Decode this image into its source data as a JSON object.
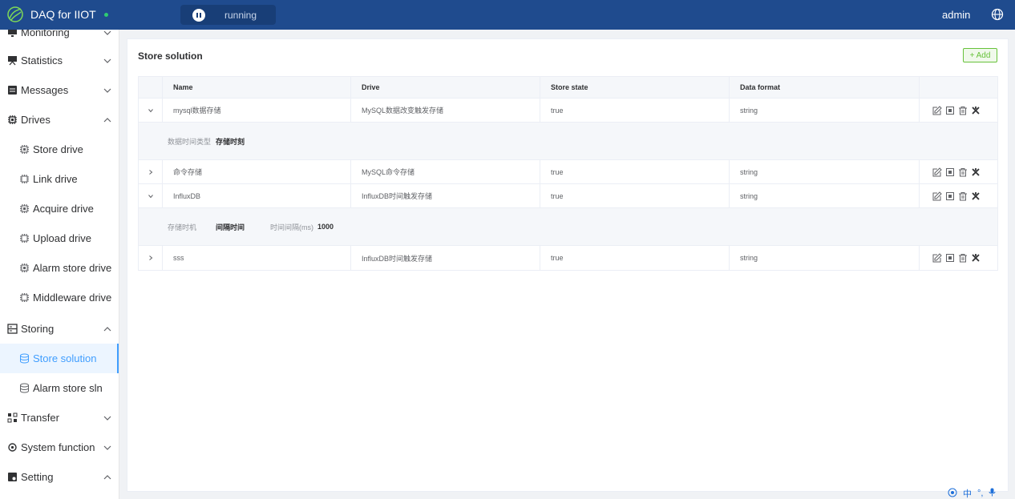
{
  "header": {
    "app_title": "DAQ for IIOT",
    "status": "running",
    "user": "admin"
  },
  "sidebar": {
    "items": [
      {
        "label": "Monitoring",
        "icon": "monitor-icon",
        "chevron": "down"
      },
      {
        "label": "Statistics",
        "icon": "presentation-icon",
        "chevron": "down"
      },
      {
        "label": "Messages",
        "icon": "message-icon",
        "chevron": "down"
      },
      {
        "label": "Drives",
        "icon": "chip-icon",
        "chevron": "up"
      },
      {
        "label": "Storing",
        "icon": "storage-icon",
        "chevron": "up"
      },
      {
        "label": "Transfer",
        "icon": "transfer-icon",
        "chevron": "down"
      },
      {
        "label": "System function",
        "icon": "system-icon",
        "chevron": "down"
      },
      {
        "label": "Setting",
        "icon": "setting-icon",
        "chevron": "up"
      }
    ],
    "drives_sub": [
      {
        "label": "Store drive"
      },
      {
        "label": "Link drive"
      },
      {
        "label": "Acquire drive"
      },
      {
        "label": "Upload drive"
      },
      {
        "label": "Alarm store drive"
      },
      {
        "label": "Middleware drive"
      }
    ],
    "storing_sub": [
      {
        "label": "Store solution",
        "active": true
      },
      {
        "label": "Alarm store sln"
      }
    ]
  },
  "main": {
    "title": "Store solution",
    "add_label": "+ Add",
    "columns": [
      "Name",
      "Drive",
      "Store state",
      "Data format"
    ],
    "rows": [
      {
        "name": "mysql数据存储",
        "drive": "MySQL数据改变触发存储",
        "state": "true",
        "format": "string",
        "expanded": true
      },
      {
        "name": "命令存储",
        "drive": "MySQL命令存储",
        "state": "true",
        "format": "string",
        "expanded": false
      },
      {
        "name": "InfluxDB",
        "drive": "InfluxDB时间触发存储",
        "state": "true",
        "format": "string",
        "expanded": true
      },
      {
        "name": "sss",
        "drive": "InfluxDB时间触发存储",
        "state": "true",
        "format": "string",
        "expanded": false
      }
    ],
    "details": [
      {
        "k1": "数据时间类型",
        "v1": "存储时刻"
      },
      {
        "k1": "存储时机",
        "v1": "间隔时间",
        "k2": "时间间隔(ms)",
        "v2": "1000"
      }
    ]
  },
  "ime": {
    "label": "中"
  },
  "colors": {
    "header": "#1f4b8e",
    "accent": "#409eff",
    "add": "#67c23a"
  }
}
